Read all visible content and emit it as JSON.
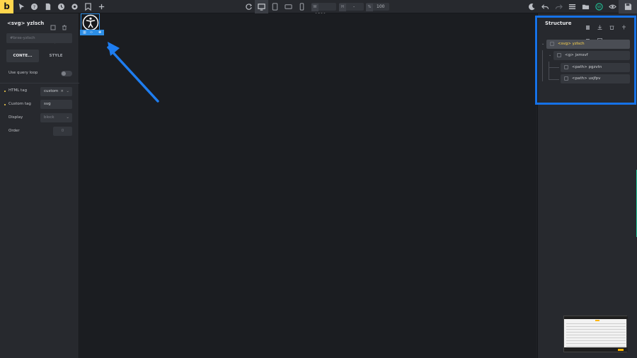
{
  "topbar": {
    "logo": "b",
    "width_label": "W",
    "width_value": "1380",
    "height_label": "H",
    "height_value": "-",
    "zoom_label": "%",
    "zoom_value": "100"
  },
  "left_panel": {
    "title": "<svg> yzlsch",
    "id_placeholder": "#brxe-yzlsch",
    "tabs": {
      "content": "CONTE...",
      "style": "STYLE"
    },
    "query_loop_label": "Use query loop",
    "query_loop_enabled": false,
    "html_tag_label": "HTML tag",
    "html_tag_value": "custom",
    "custom_tag_label": "Custom tag",
    "custom_tag_value": "svg",
    "display_label": "Display",
    "display_value": "block",
    "order_label": "Order",
    "order_value": "0"
  },
  "structure": {
    "title": "Structure",
    "nodes": [
      {
        "label": "<svg> yzlsch",
        "active": true
      },
      {
        "label": "<g> jxmsvf",
        "active": false
      },
      {
        "label": "<path> pgzvtn",
        "active": false
      },
      {
        "label": "<path> uxjfpv",
        "active": false
      }
    ]
  },
  "colors": {
    "accent": "#ffd64d",
    "selection": "#2d8ee6",
    "highlight": "#1672e8",
    "panel": "#27292e",
    "canvas": "#1b1d21"
  }
}
